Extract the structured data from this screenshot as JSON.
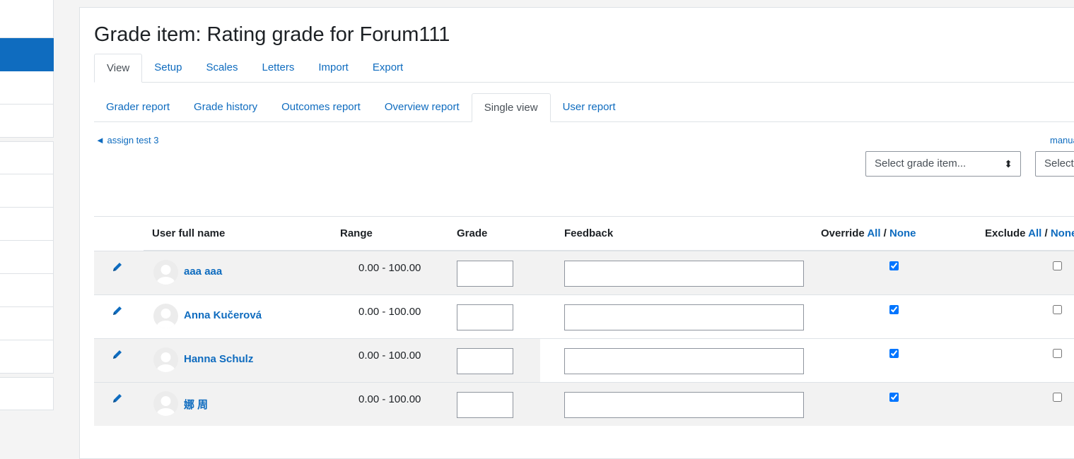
{
  "page": {
    "title": "Grade item: Rating grade for Forum111"
  },
  "tabs_primary": [
    {
      "label": "View",
      "active": true
    },
    {
      "label": "Setup",
      "active": false
    },
    {
      "label": "Scales",
      "active": false
    },
    {
      "label": "Letters",
      "active": false
    },
    {
      "label": "Import",
      "active": false
    },
    {
      "label": "Export",
      "active": false
    }
  ],
  "tabs_secondary": [
    {
      "label": "Grader report",
      "active": false
    },
    {
      "label": "Grade history",
      "active": false
    },
    {
      "label": "Outcomes report",
      "active": false
    },
    {
      "label": "Overview report",
      "active": false
    },
    {
      "label": "Single view",
      "active": true
    },
    {
      "label": "User report",
      "active": false
    }
  ],
  "nav": {
    "prev_label": "◄ assign test 3",
    "next_label": "manua"
  },
  "selects": {
    "grade_item": "Select grade item...",
    "user": "Select"
  },
  "table": {
    "headers": {
      "name": "User full name",
      "range": "Range",
      "grade": "Grade",
      "feedback": "Feedback",
      "override": "Override",
      "exclude": "Exclude",
      "all": "All",
      "none": "None",
      "sep": "/"
    },
    "rows": [
      {
        "name": "aaa aaa",
        "range": "0.00 - 100.00",
        "grade": "",
        "feedback": "",
        "override": true,
        "exclude": false
      },
      {
        "name": "Anna Kučerová",
        "range": "0.00 - 100.00",
        "grade": "",
        "feedback": "",
        "override": true,
        "exclude": false
      },
      {
        "name": "Hanna Schulz",
        "range": "0.00 - 100.00",
        "grade": "",
        "feedback": "",
        "override": true,
        "exclude": false
      },
      {
        "name": "娜 周",
        "range": "0.00 - 100.00",
        "grade": "",
        "feedback": "",
        "override": true,
        "exclude": false
      }
    ]
  },
  "colors": {
    "link": "#0f6cbf",
    "sidebar_active": "#0f6cbf",
    "row_stripe": "#f2f2f2"
  },
  "icons": {
    "edit": "pencil-icon",
    "avatar": "user-avatar-icon",
    "select_caret": "up-down-caret-icon"
  }
}
